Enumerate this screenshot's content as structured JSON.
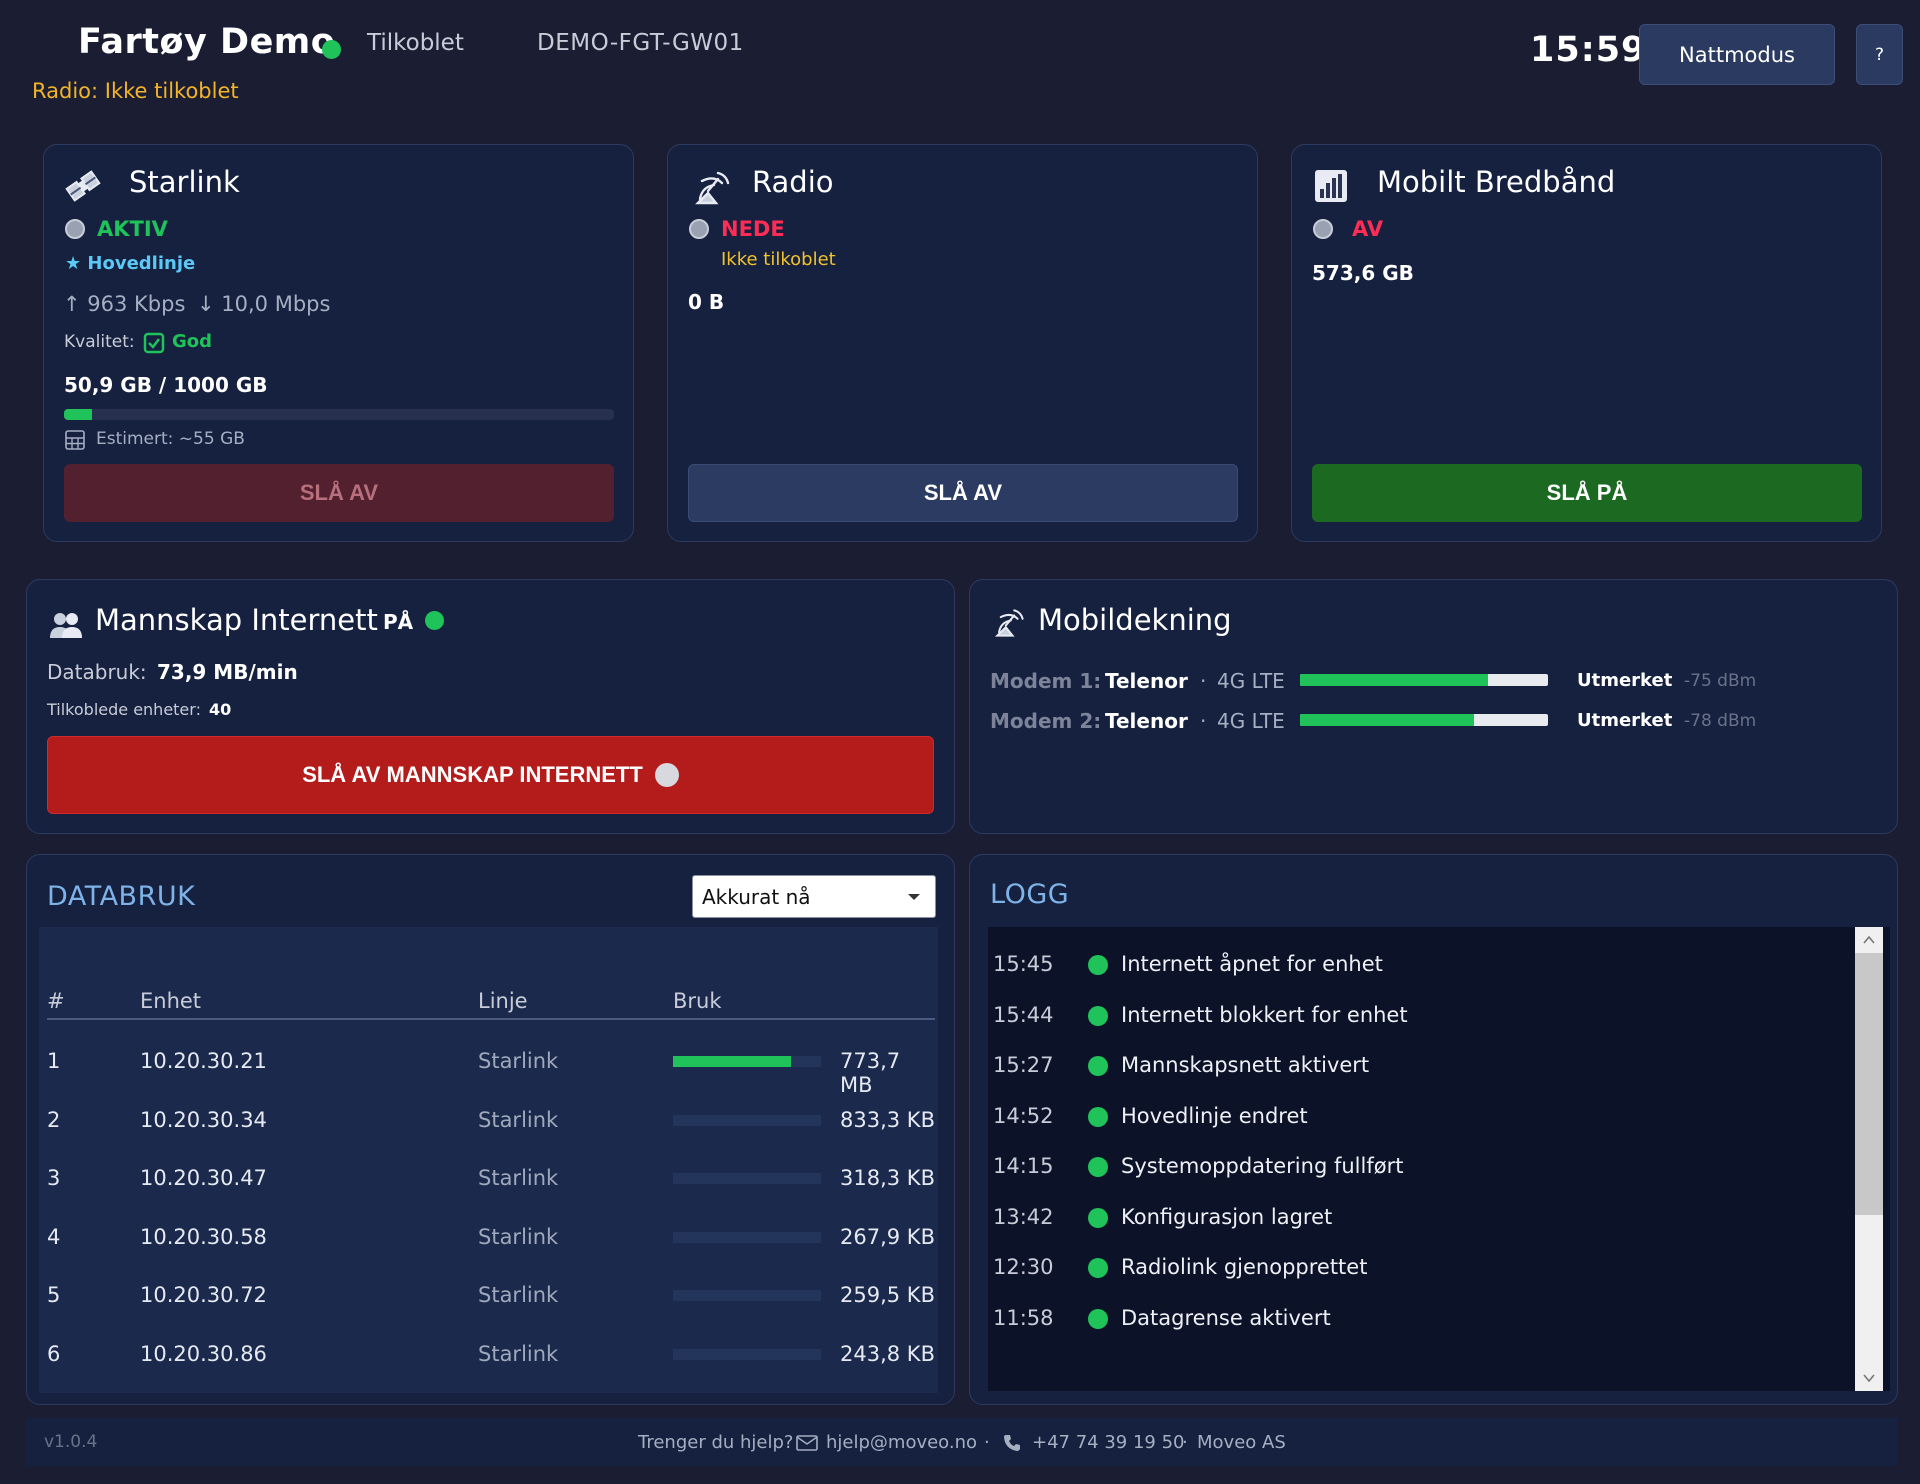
{
  "header": {
    "title": "Fartøy Demo",
    "status": "Tilkoblet",
    "device_id": "DEMO-FGT-GW01",
    "radio_status": "Radio: Ikke tilkoblet",
    "clock": "15:59",
    "night_mode_label": "Nattmodus",
    "help_label": "?",
    "status_color": "#1fc35a"
  },
  "starlink": {
    "title": "Starlink",
    "icon": "satellite-icon",
    "state": "AKTIV",
    "state_color": "#1fc35a",
    "main_line": "★ Hovedlinje",
    "upload": "↑ 963 Kbps",
    "download": "↓ 10,0 Mbps",
    "quality_label": "Kvalitet:",
    "quality_value": "God",
    "usage": "50,9 GB / 1000 GB",
    "usage_fraction": 0.051,
    "estimate": "Estimert: ~55 GB",
    "button_label": "SLÅ AV"
  },
  "radio": {
    "title": "Radio",
    "icon": "antenna-icon",
    "state": "NEDE",
    "state_color": "#ff2d55",
    "substate": "Ikke tilkoblet",
    "usage": "0 B",
    "button_label": "SLÅ AV"
  },
  "mobile": {
    "title": "Mobilt Bredbånd",
    "icon": "signal-chart-icon",
    "state": "AV",
    "state_color": "#ff2d55",
    "usage": "573,6 GB",
    "button_label": "SLÅ PÅ"
  },
  "crew": {
    "title": "Mannskap Internett",
    "icon": "people-icon",
    "state": "PÅ",
    "data_label": "Databruk:",
    "data_value": "73,9 MB/min",
    "devices_label": "Tilkoblede enheter:",
    "devices_value": "40",
    "button_label": "SLÅ AV MANNSKAP INTERNETT"
  },
  "coverage": {
    "title": "Mobildekning",
    "icon": "antenna-icon",
    "modems": [
      {
        "label": "Modem 1:",
        "operator": "Telenor",
        "sep": "·",
        "tech": "4G LTE",
        "level": 0.76,
        "quality": "Utmerket",
        "dbm": "-75 dBm"
      },
      {
        "label": "Modem 2:",
        "operator": "Telenor",
        "sep": "·",
        "tech": "4G LTE",
        "level": 0.7,
        "quality": "Utmerket",
        "dbm": "-78 dBm"
      }
    ]
  },
  "databruk": {
    "title": "DATABRUK",
    "period": "Akkurat nå",
    "columns": [
      "#",
      "Enhet",
      "Linje",
      "Bruk"
    ],
    "rows": [
      {
        "n": "1",
        "ip": "10.20.30.21",
        "line": "Starlink",
        "usage": "773,7 MB",
        "fraction": 0.8
      },
      {
        "n": "2",
        "ip": "10.20.30.34",
        "line": "Starlink",
        "usage": "833,3 KB",
        "fraction": 0.0
      },
      {
        "n": "3",
        "ip": "10.20.30.47",
        "line": "Starlink",
        "usage": "318,3 KB",
        "fraction": 0.0
      },
      {
        "n": "4",
        "ip": "10.20.30.58",
        "line": "Starlink",
        "usage": "267,9 KB",
        "fraction": 0.0
      },
      {
        "n": "5",
        "ip": "10.20.30.72",
        "line": "Starlink",
        "usage": "259,5 KB",
        "fraction": 0.0
      },
      {
        "n": "6",
        "ip": "10.20.30.86",
        "line": "Starlink",
        "usage": "243,8 KB",
        "fraction": 0.0
      }
    ]
  },
  "log": {
    "title": "LOGG",
    "entries": [
      {
        "time": "15:45",
        "msg": "Internett åpnet for enhet"
      },
      {
        "time": "15:44",
        "msg": "Internett blokkert for enhet"
      },
      {
        "time": "15:27",
        "msg": "Mannskapsnett aktivert"
      },
      {
        "time": "14:52",
        "msg": "Hovedlinje endret"
      },
      {
        "time": "14:15",
        "msg": "Systemoppdatering fullført"
      },
      {
        "time": "13:42",
        "msg": "Konfigurasjon lagret"
      },
      {
        "time": "12:30",
        "msg": "Radiolink gjenopprettet"
      },
      {
        "time": "11:58",
        "msg": "Datagrense aktivert"
      }
    ]
  },
  "footer": {
    "version": "v1.0.4",
    "help_text": "Trenger du hjelp?",
    "email": "hjelp@moveo.no",
    "sep": "·",
    "phone": "+47 74 39 19 50",
    "company": "Moveo AS"
  }
}
